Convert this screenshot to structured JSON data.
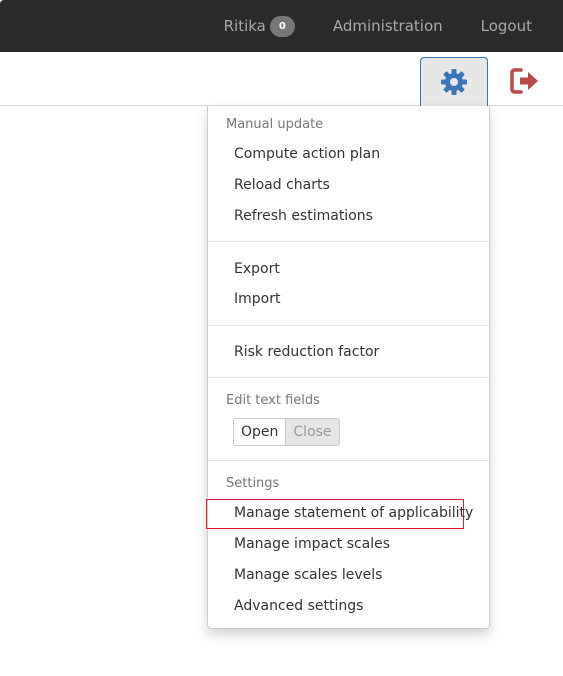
{
  "topnav": {
    "user": "Ritika",
    "badge_count": "0",
    "administration": "Administration",
    "logout": "Logout"
  },
  "toolbar": {
    "gear_icon": "gear-icon",
    "logout_icon": "sign-out-icon",
    "accent_color": "#3a76b8",
    "logout_color": "#b94a48"
  },
  "menu": {
    "manual_update": {
      "header": "Manual update",
      "items": [
        "Compute action plan",
        "Reload charts",
        "Refresh estimations"
      ]
    },
    "data": {
      "items": [
        "Export",
        "Import"
      ]
    },
    "risk": {
      "items": [
        "Risk reduction factor"
      ]
    },
    "edit_text": {
      "header": "Edit text fields",
      "open": "Open",
      "close": "Close"
    },
    "settings": {
      "header": "Settings",
      "items": [
        "Manage statement of applicability",
        "Manage impact scales",
        "Manage scales levels",
        "Advanced settings"
      ]
    }
  }
}
